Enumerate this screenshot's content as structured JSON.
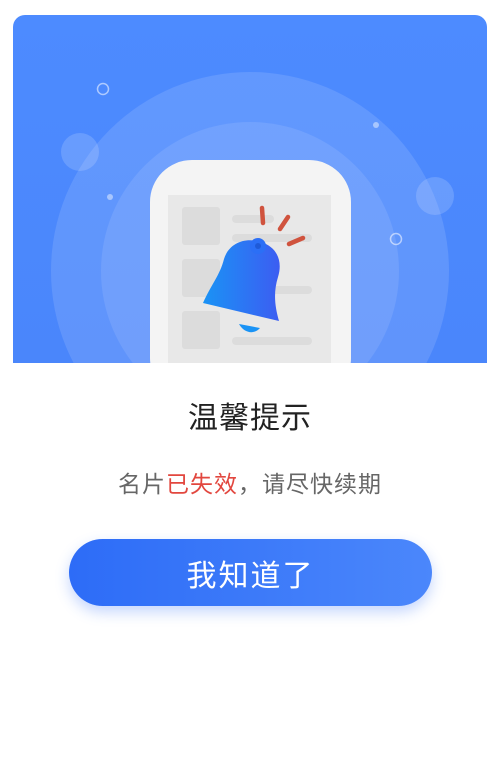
{
  "dialog": {
    "illustration": {
      "icon": "bell-icon",
      "colors": {
        "background": "#4a86fb",
        "bell_start": "#1a93f5",
        "bell_end": "#3c5df2",
        "rays": "#d0533e"
      }
    },
    "title": "温馨提示",
    "message": {
      "prefix": "名片",
      "highlight": "已失效",
      "suffix": "，请尽快续期"
    },
    "confirm_button_label": "我知道了",
    "colors": {
      "highlight": "#e2473f",
      "button": "#2d6cf7",
      "title": "#222222",
      "message": "#666666"
    }
  }
}
